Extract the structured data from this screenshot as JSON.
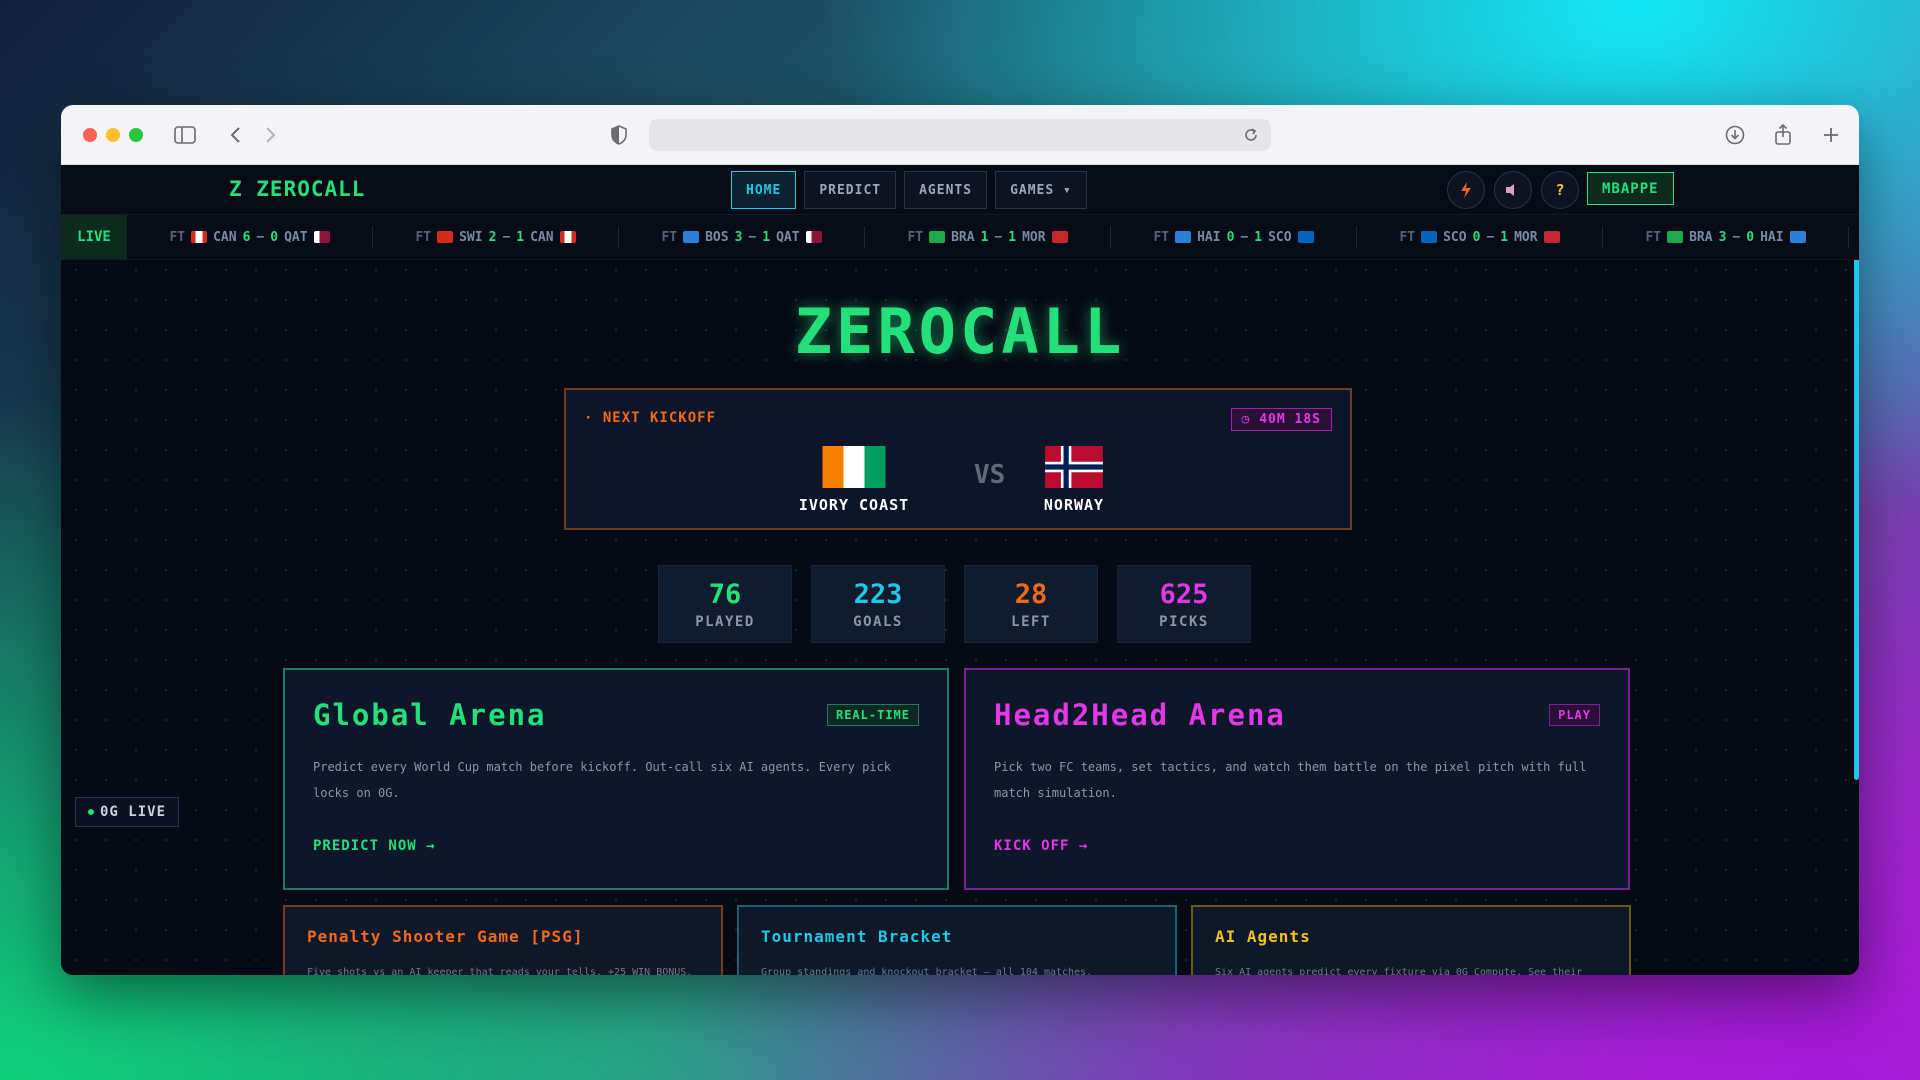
{
  "nav": {
    "brand": "Z ZEROCALL",
    "items": [
      {
        "label": "HOME"
      },
      {
        "label": "PREDICT"
      },
      {
        "label": "AGENTS"
      },
      {
        "label": "GAMES ▾"
      }
    ],
    "user": "MBAPPE"
  },
  "ticker": {
    "live_label": "LIVE",
    "matches": [
      {
        "status": "FT",
        "home": "CAN",
        "home_score": "6",
        "away_score": "0",
        "away": "QAT"
      },
      {
        "status": "FT",
        "home": "SWI",
        "home_score": "2",
        "away_score": "1",
        "away": "CAN"
      },
      {
        "status": "FT",
        "home": "BOS",
        "home_score": "3",
        "away_score": "1",
        "away": "QAT"
      },
      {
        "status": "FT",
        "home": "BRA",
        "home_score": "1",
        "away_score": "1",
        "away": "MOR"
      },
      {
        "status": "FT",
        "home": "HAI",
        "home_score": "0",
        "away_score": "1",
        "away": "SCO"
      },
      {
        "status": "FT",
        "home": "SCO",
        "home_score": "0",
        "away_score": "1",
        "away": "MOR"
      },
      {
        "status": "FT",
        "home": "BRA",
        "home_score": "3",
        "away_score": "0",
        "away": "HAI"
      }
    ]
  },
  "hero": {
    "title": "ZEROCALL"
  },
  "kickoff": {
    "label": "· NEXT KICKOFF",
    "timer": "◷ 40M 18S",
    "home": "IVORY COAST",
    "away": "NORWAY",
    "vs": "VS"
  },
  "stats": [
    {
      "value": "76",
      "label": "PLAYED",
      "color": "#23e07a"
    },
    {
      "value": "223",
      "label": "GOALS",
      "color": "#1ec8e6"
    },
    {
      "value": "28",
      "label": "LEFT",
      "color": "#f06a1c"
    },
    {
      "value": "625",
      "label": "PICKS",
      "color": "#e238e8"
    }
  ],
  "arenas": {
    "global": {
      "title": "Global Arena",
      "badge": "REAL-TIME",
      "desc": "Predict every World Cup match before kickoff. Out-call six AI agents. Every pick locks on 0G.",
      "link": "PREDICT NOW →"
    },
    "h2h": {
      "title": "Head2Head Arena",
      "badge": "PLAY",
      "desc": "Pick two FC teams, set tactics, and watch them battle on the pixel pitch with full match simulation.",
      "link": "KICK OFF →"
    }
  },
  "cards": [
    {
      "title": "Penalty Shooter Game [PSG]",
      "desc": "Five shots vs an AI keeper that reads your tells. +25 WIN BONUS."
    },
    {
      "title": "Tournament Bracket",
      "desc": "Group standings and knockout bracket — all 104 matches."
    },
    {
      "title": "AI Agents",
      "desc": "Six AI agents predict every fixture via 0G Compute. See their"
    }
  ],
  "og_live": "0G LIVE",
  "colors": {
    "green": "#23e07a",
    "cyan": "#1ec8e6",
    "orange": "#f06a1c",
    "magenta": "#e238e8",
    "yellow": "#f2c21b"
  }
}
